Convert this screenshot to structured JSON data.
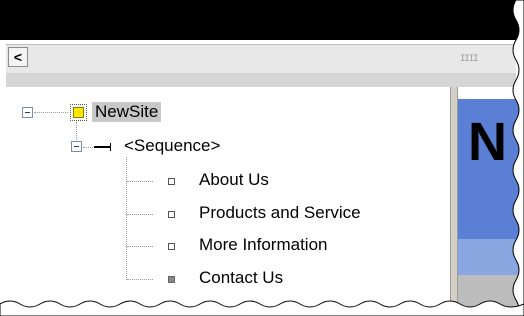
{
  "toolbar": {
    "scroll_left_glyph": "<",
    "scroll_grip": "IIII"
  },
  "tree": {
    "root": {
      "label": "NewSite",
      "icon": "site-icon"
    },
    "sequence": {
      "label": "<Sequence>",
      "icon": "sequence-icon"
    },
    "pages": [
      {
        "label": "About Us",
        "icon": "page-icon"
      },
      {
        "label": "Products and Service",
        "icon": "page-icon"
      },
      {
        "label": "More Information",
        "icon": "page-icon"
      },
      {
        "label": "Contact Us",
        "icon": "page-icon-filled"
      }
    ]
  },
  "preview": {
    "heading_fragment": "N"
  },
  "colors": {
    "selection": "#c8c8c8",
    "site_icon_fill": "#ffe600",
    "preview_blue": "#5a7fd4",
    "preview_light_blue": "#8aa6e0"
  }
}
